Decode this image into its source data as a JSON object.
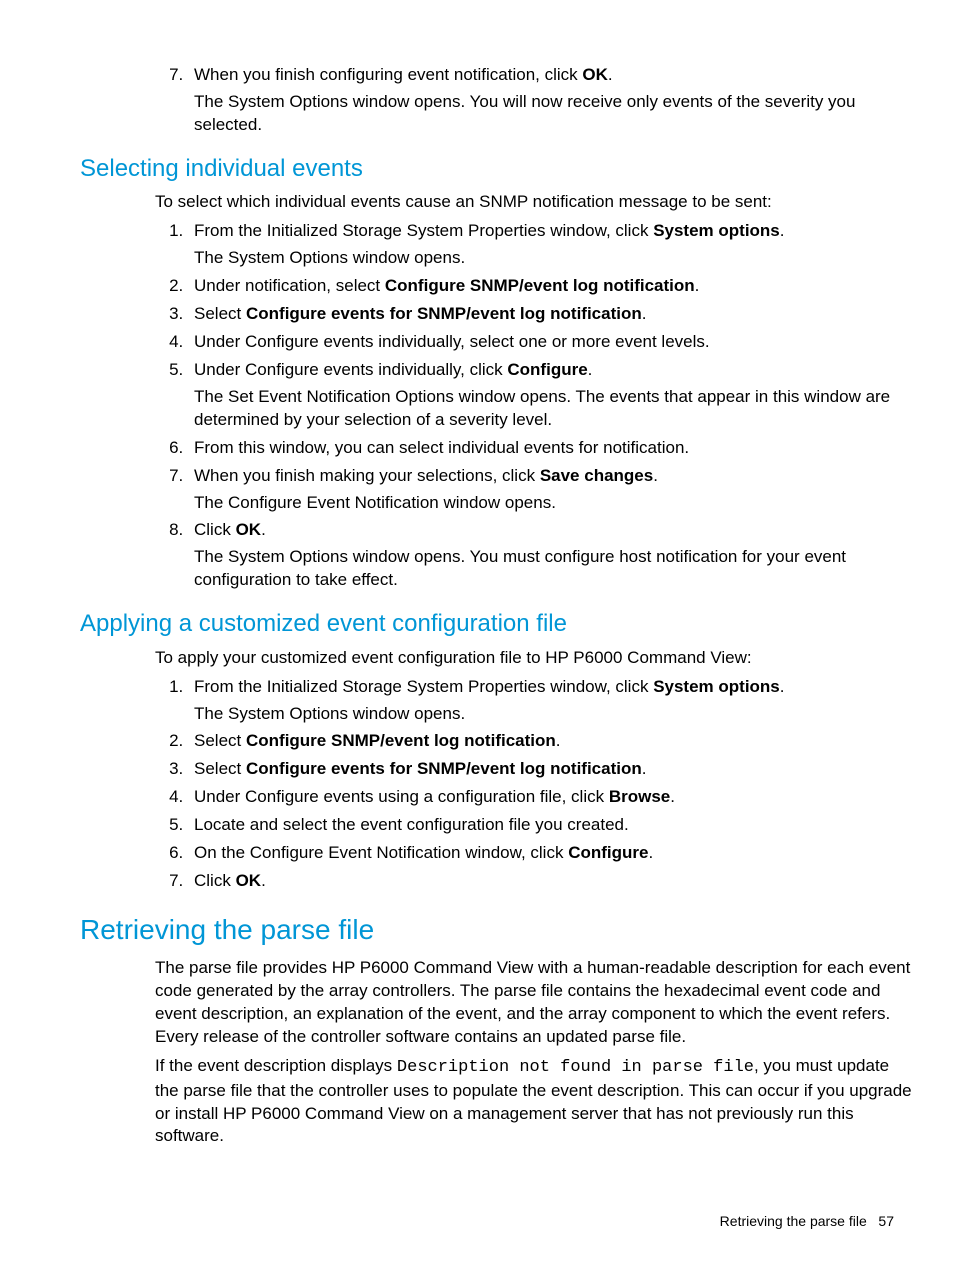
{
  "topSteps": {
    "start": 7,
    "items": [
      {
        "main_pre": "When you finish configuring event notification, click ",
        "bold": "OK",
        "main_post": ".",
        "sub": "The System Options window opens. You will now receive only events of the severity you selected."
      }
    ]
  },
  "section1": {
    "heading": "Selecting individual events",
    "intro": "To select which individual events cause an SNMP notification message to be sent:",
    "steps": [
      {
        "main_pre": "From the Initialized Storage System Properties window, click ",
        "bold": "System options",
        "main_post": ".",
        "sub": "The System Options window opens."
      },
      {
        "main_pre": "Under notification, select ",
        "bold": "Configure SNMP/event log notification",
        "main_post": "."
      },
      {
        "main_pre": "Select ",
        "bold": "Configure events for SNMP/event log notification",
        "main_post": "."
      },
      {
        "main_pre": "Under Configure events individually, select one or more event levels.",
        "bold": "",
        "main_post": ""
      },
      {
        "main_pre": "Under Configure events individually, click ",
        "bold": "Configure",
        "main_post": ".",
        "sub": "The Set Event Notification Options window opens. The events that appear in this window are determined by your selection of a severity level."
      },
      {
        "main_pre": "From this window, you can select individual events for notification.",
        "bold": "",
        "main_post": ""
      },
      {
        "main_pre": "When you finish making your selections, click ",
        "bold": "Save changes",
        "main_post": ".",
        "sub": "The Configure Event Notification window opens."
      },
      {
        "main_pre": "Click ",
        "bold": "OK",
        "main_post": ".",
        "sub": "The System Options window opens. You must configure host notification for your event configuration to take effect."
      }
    ]
  },
  "section2": {
    "heading": "Applying a customized event configuration file",
    "intro": "To apply your customized event configuration file to HP P6000 Command View:",
    "steps": [
      {
        "main_pre": "From the Initialized Storage System Properties window, click ",
        "bold": "System options",
        "main_post": ".",
        "sub": "The System Options window opens."
      },
      {
        "main_pre": "Select ",
        "bold": "Configure SNMP/event log notification",
        "main_post": "."
      },
      {
        "main_pre": "Select ",
        "bold": "Configure events for SNMP/event log notification",
        "main_post": "."
      },
      {
        "main_pre": "Under Configure events using a configuration file, click ",
        "bold": "Browse",
        "main_post": "."
      },
      {
        "main_pre": "Locate and select the event configuration file you created.",
        "bold": "",
        "main_post": ""
      },
      {
        "main_pre": "On the Configure Event Notification window, click ",
        "bold": "Configure",
        "main_post": "."
      },
      {
        "main_pre": "Click ",
        "bold": "OK",
        "main_post": "."
      }
    ]
  },
  "section3": {
    "heading": "Retrieving the parse file",
    "para1": "The parse file provides HP P6000 Command View with a human-readable description for each event code generated by the array controllers. The parse file contains the hexadecimal event code and event description, an explanation of the event, and the array component to which the event refers. Every release of the controller software contains an updated parse file.",
    "para2_pre": "If the event description displays ",
    "para2_mono": "Description not found in parse file",
    "para2_post": ", you must update the parse file that the controller uses to populate the event description. This can occur if you upgrade or install HP P6000 Command View on a management server that has not previously run this software.",
    "footer_label": "Retrieving the parse file",
    "page_number": "57"
  }
}
